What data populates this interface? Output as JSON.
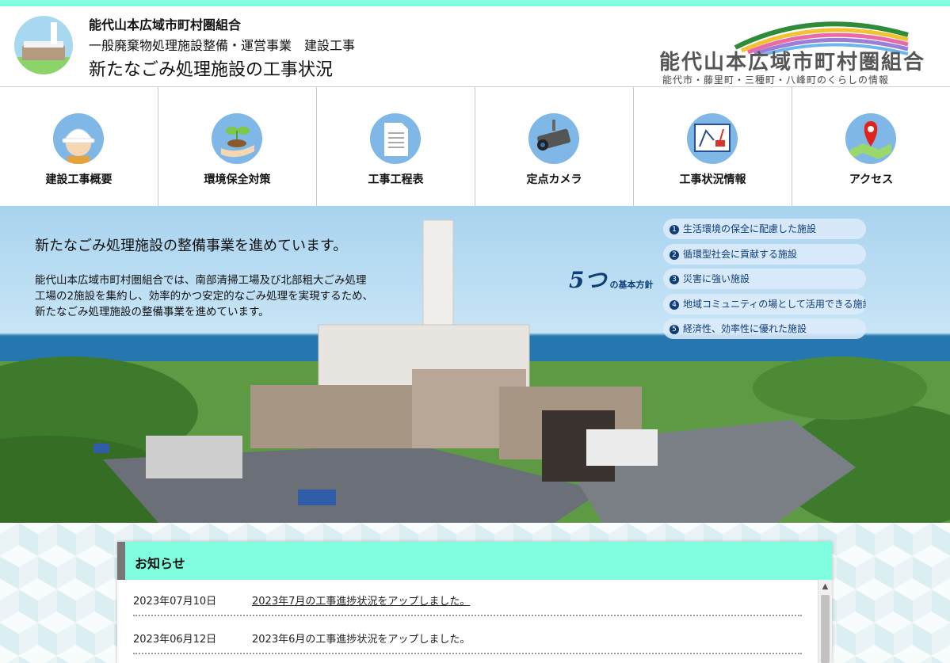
{
  "header": {
    "org_name": "能代山本広域市町村圏組合",
    "project_name": "一般廃棄物処理施設整備・運営事業　建設工事",
    "page_title": "新たなごみ処理施設の工事状況",
    "logo_title": "能代山本広域市町村圏組合",
    "logo_tagline": "能代市・藤里町・三種町・八峰町のくらしの情報"
  },
  "nav": {
    "items": [
      {
        "label": "建設工事概要",
        "icon": "worker-helmet-icon"
      },
      {
        "label": "環境保全対策",
        "icon": "seedling-hand-icon"
      },
      {
        "label": "工事工程表",
        "icon": "document-icon"
      },
      {
        "label": "定点カメラ",
        "icon": "security-camera-icon"
      },
      {
        "label": "工事状況情報",
        "icon": "crane-board-icon"
      },
      {
        "label": "アクセス",
        "icon": "map-pin-icon"
      }
    ]
  },
  "hero": {
    "heading": "新たなごみ処理施設の整備事業を進めています。",
    "body": "能代山本広域市町村圏組合では、南部清掃工場及び北部粗大ごみ処理工場の2施設を集約し、効率的かつ安定的なごみ処理を実現するため、新たなごみ処理施設の整備事業を進めています。",
    "policy_number": "5つ",
    "policy_label": "の基本方針",
    "policies": [
      {
        "num": "1",
        "text": "生活環境の保全に配慮した施設"
      },
      {
        "num": "2",
        "text": "循環型社会に貢献する施設"
      },
      {
        "num": "3",
        "text": "災害に強い施設"
      },
      {
        "num": "4",
        "text": "地域コミュニティの場として活用できる施設"
      },
      {
        "num": "5",
        "text": "経済性、効率性に優れた施設"
      }
    ]
  },
  "news": {
    "title": "お知らせ",
    "items": [
      {
        "date": "2023年07月10日",
        "text": "2023年7月の工事進捗状況をアップしました。"
      },
      {
        "date": "2023年06月12日",
        "text": "2023年6月の工事進捗状況をアップしました。"
      }
    ]
  },
  "colors": {
    "accent": "#7fffe0",
    "nav_icon_bg": "#7fb8e6",
    "policy_text": "#0e3e78"
  }
}
